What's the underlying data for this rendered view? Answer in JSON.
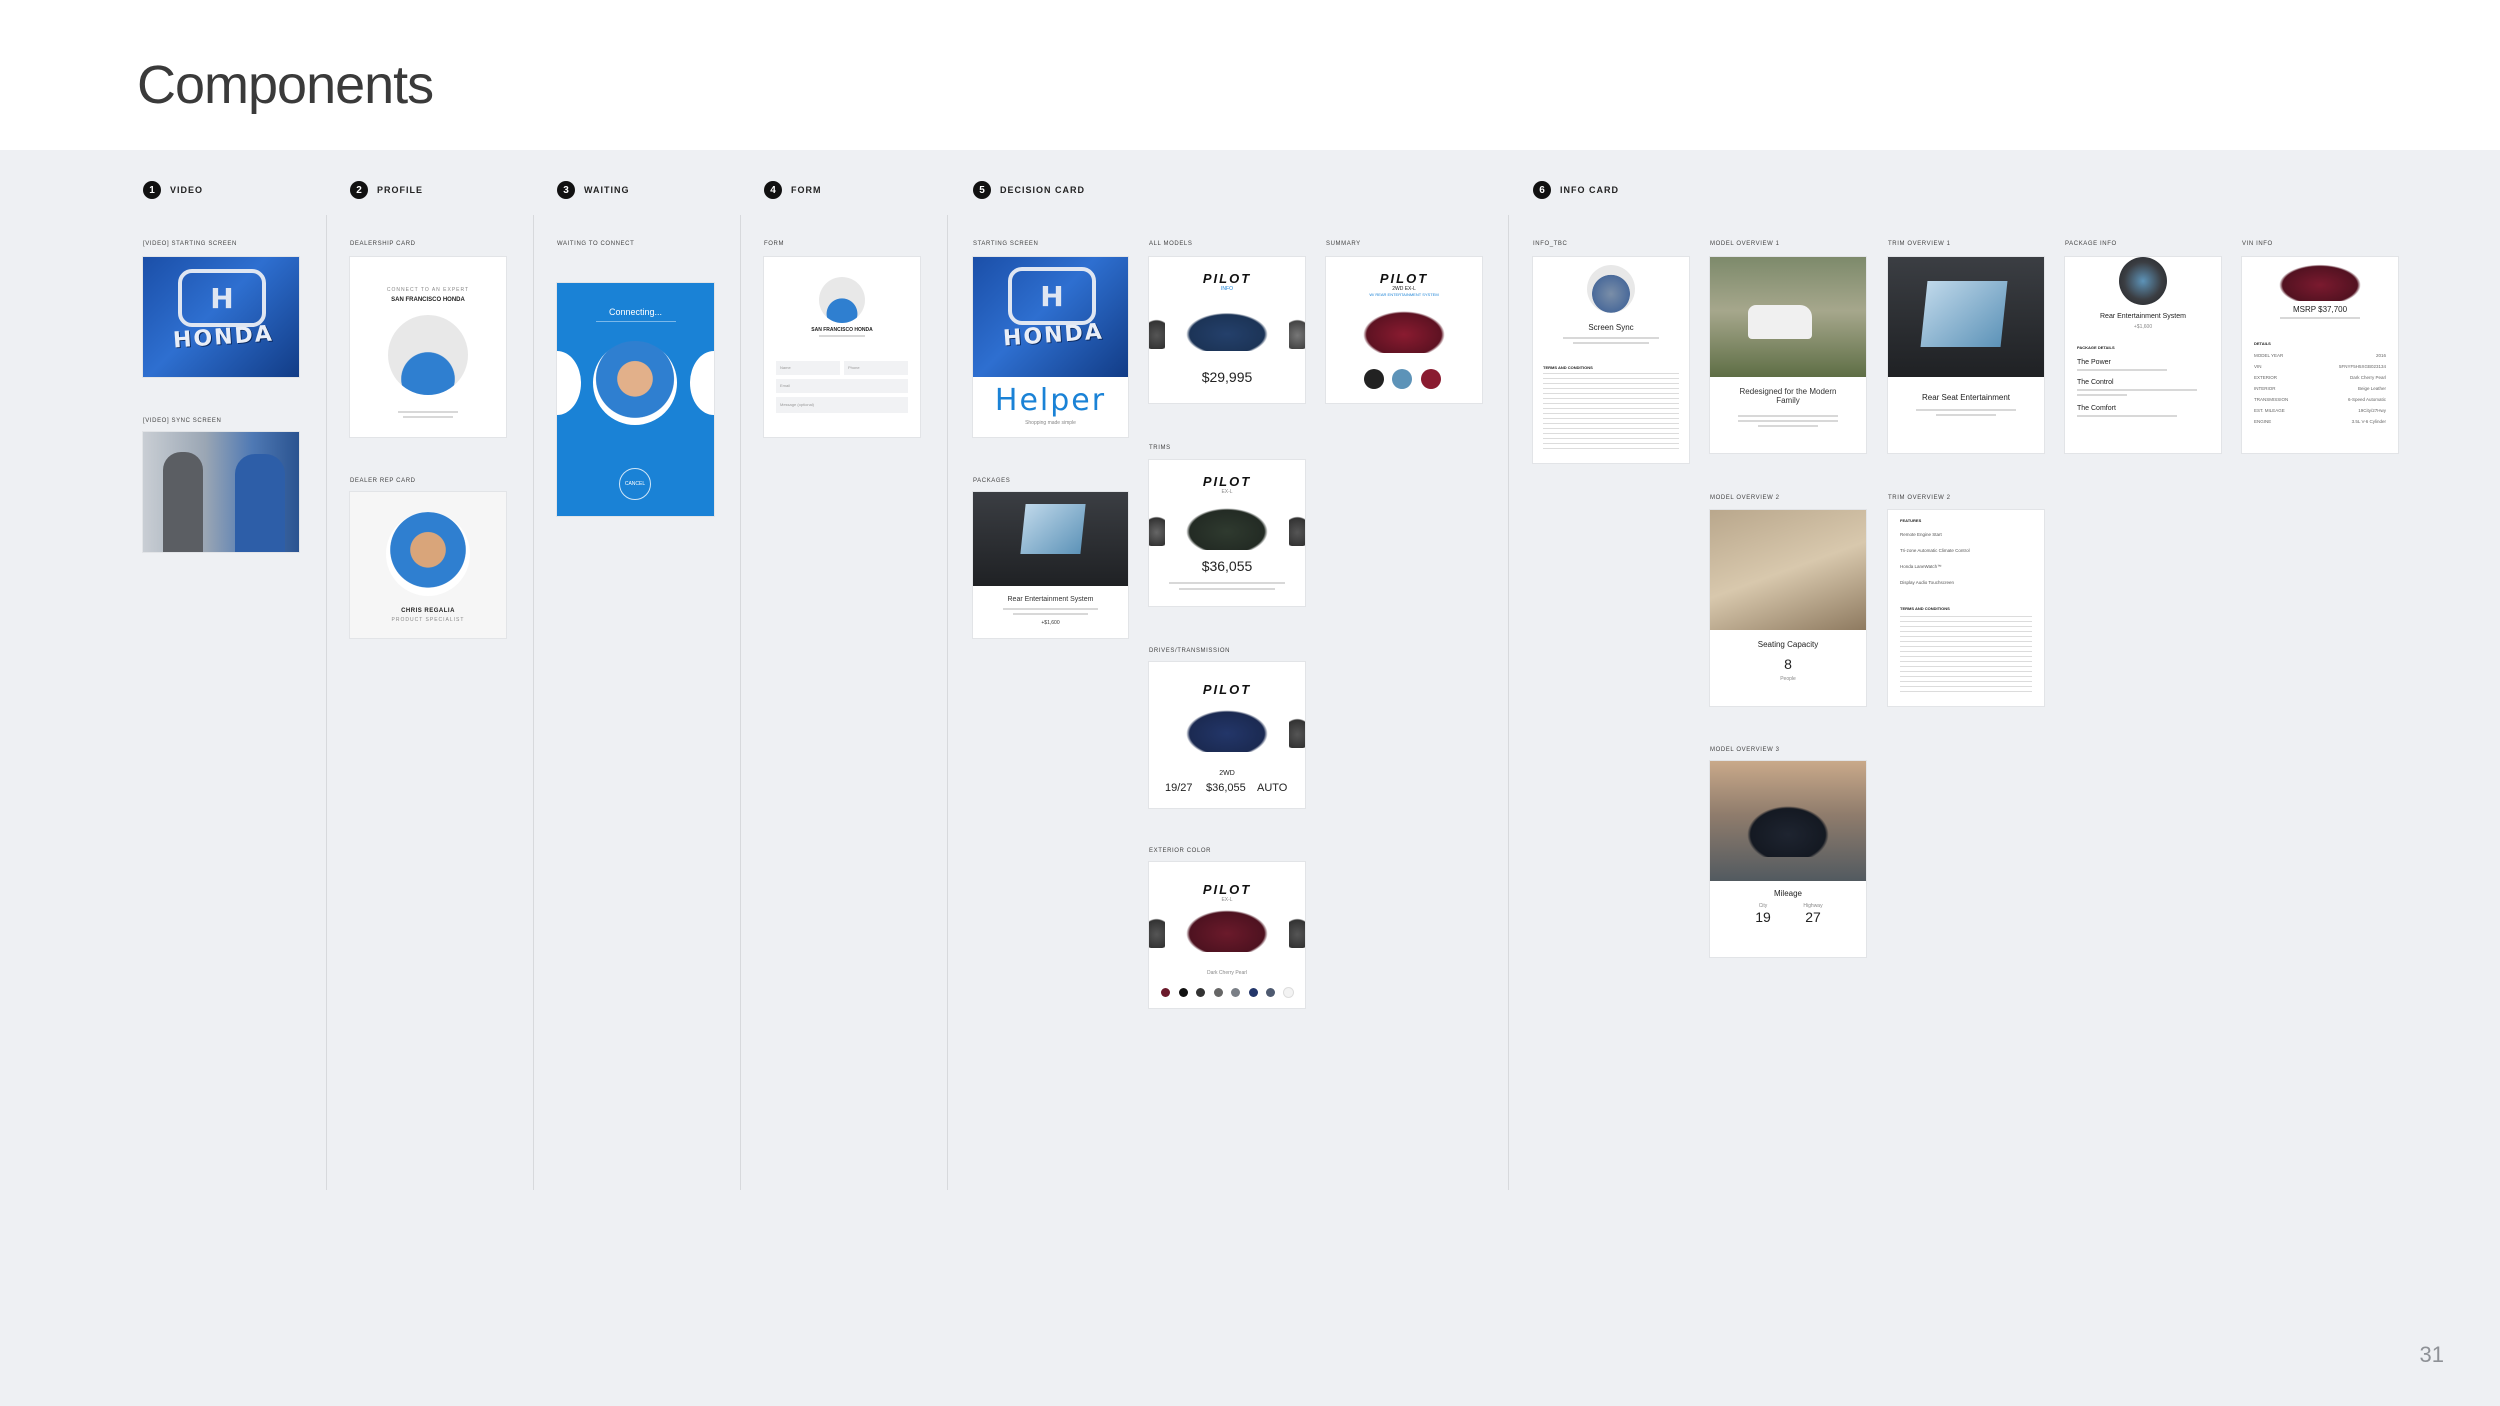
{
  "page": {
    "title": "Components",
    "number": "31"
  },
  "sections": {
    "s1": {
      "num": "1",
      "label": "VIDEO"
    },
    "s2": {
      "num": "2",
      "label": "PROFILE"
    },
    "s3": {
      "num": "3",
      "label": "WAITING"
    },
    "s4": {
      "num": "4",
      "label": "FORM"
    },
    "s5": {
      "num": "5",
      "label": "DECISION CARD"
    },
    "s6": {
      "num": "6",
      "label": "INFO CARD"
    }
  },
  "video": {
    "starting_label": "[VIDEO] STARTING SCREEN",
    "sync_label": "[VIDEO] SYNC SCREEN",
    "honda_word": "HONDA"
  },
  "profile": {
    "dealership_label": "DEALERSHIP CARD",
    "dealer_connect": "CONNECT TO AN EXPERT",
    "dealer_name": "SAN FRANCISCO HONDA",
    "rep_label": "DEALER REP CARD",
    "rep_name": "CHRIS REGALIA",
    "rep_title": "PRODUCT SPECIALIST"
  },
  "waiting": {
    "label": "WAITING TO CONNECT",
    "connecting": "Connecting...",
    "cancel": "CANCEL"
  },
  "form": {
    "label": "FORM",
    "dealer_name": "SAN FRANCISCO HONDA",
    "name_placeholder": "Name",
    "phone_placeholder": "Phone",
    "email_placeholder": "Email",
    "message_placeholder": "Message (optional)"
  },
  "decision": {
    "starting_label": "STARTING SCREEN",
    "helper": "Helper",
    "helper_tagline": "Shopping made simple",
    "packages_label": "PACKAGES",
    "package_name": "Rear Entertainment System",
    "package_price": "+$1,600",
    "all_models_label": "ALL MODELS",
    "model": "PILOT",
    "all_models_sub": "INFO",
    "all_models_price": "$29,995",
    "trims_label": "TRIMS",
    "trim_sub": "EX-L",
    "trim_price": "$36,055",
    "drives_label": "DRIVES/TRANSMISSION",
    "drive_type": "2WD",
    "drive_mpg": "19/27",
    "drive_price": "$36,055",
    "drive_trans": "AUTO",
    "exterior_label": "EXTERIOR COLOR",
    "exterior_sub": "EX-L",
    "exterior_color": "Dark Cherry Pearl",
    "summary_label": "SUMMARY",
    "summary_sub": "2WD EX-L",
    "summary_pkg": "W/ REAR ENTERTAINMENT SYSTEM"
  },
  "info": {
    "tbc_label": "INFO_TBC",
    "tbc_title": "Screen Sync",
    "tbc_terms": "TERMS AND CONDITIONS",
    "mo1_label": "MODEL OVERVIEW 1",
    "mo1_title": "Redesigned for the Modern Family",
    "mo2_label": "MODEL OVERVIEW 2",
    "mo2_title": "Seating Capacity",
    "mo2_value": "8",
    "mo2_unit": "People",
    "mo3_label": "MODEL OVERVIEW 3",
    "mo3_title": "Mileage",
    "mo3_city_label": "City",
    "mo3_city": "19",
    "mo3_hwy_label": "Highway",
    "mo3_hwy": "27",
    "to1_label": "TRIM OVERVIEW 1",
    "to1_title": "Rear Seat Entertainment",
    "to2_label": "TRIM OVERVIEW 2",
    "to2_features": [
      "Remote Engine Start",
      "Tri-zone Automatic Climate Control",
      "Honda LaneWatch™",
      "Display Audio Touchscreen"
    ],
    "to2_terms": "TERMS AND CONDITIONS",
    "pkg_label": "PACKAGE INFO",
    "pkg_title": "Rear Entertainment System",
    "pkg_price": "+$1,600",
    "pkg_details": "PACKAGE DETAILS",
    "pkg_items": [
      "The Power",
      "The Control",
      "The Comfort"
    ],
    "vin_label": "VIN INFO",
    "vin_msrp": "MSRP $37,700",
    "vin_details": "DETAILS",
    "vin_rows": [
      [
        "MODEL YEAR",
        "2016"
      ],
      [
        "VIN",
        "5FNYF5H5XGB023134"
      ],
      [
        "EXTERIOR",
        "Dark Cherry Pearl"
      ],
      [
        "INTERIOR",
        "Beige Leather"
      ],
      [
        "TRANSMISSION",
        "6-Speed Automatic"
      ],
      [
        "EST. MILEAGE",
        "19City/27Hwy"
      ],
      [
        "ENGINE",
        "3.5L V-6 Cylinder"
      ]
    ]
  },
  "colors": {
    "board": "#eef0f3",
    "honda_blue": "#1b4fa8",
    "waiting_blue": "#1a82d6",
    "link_blue": "#1a82d6"
  }
}
